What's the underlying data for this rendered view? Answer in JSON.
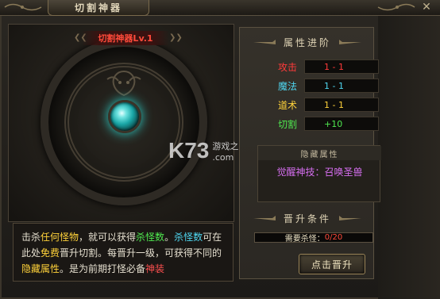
{
  "window": {
    "title": "切割神器",
    "close_icon": "close-icon"
  },
  "artifact": {
    "name": "切割神器Lv.1",
    "gem_color": "#2bd6cf"
  },
  "watermark": {
    "logo": "K73",
    "text": "游戏之家",
    "url": ".com"
  },
  "description": {
    "segments": [
      {
        "text": "击杀",
        "color": "default"
      },
      {
        "text": "任何怪物",
        "color": "yellow"
      },
      {
        "text": "，就可以获得",
        "color": "default"
      },
      {
        "text": "杀怪数",
        "color": "green"
      },
      {
        "text": "。",
        "color": "default"
      },
      {
        "text": "杀怪数",
        "color": "cyan"
      },
      {
        "text": "可在此处",
        "color": "default"
      },
      {
        "text": "免费",
        "color": "yellow"
      },
      {
        "text": "晋升切割。每晋升一级，可获得不同的",
        "color": "default"
      },
      {
        "text": "隐藏属性",
        "color": "yellow"
      },
      {
        "text": "。是为前期打怪必备",
        "color": "default"
      },
      {
        "text": "神装",
        "color": "red"
      }
    ]
  },
  "attributes": {
    "heading": "属性进阶",
    "rows": [
      {
        "label": "攻击",
        "value": "1 - 1",
        "label_color": "#ff3a3a",
        "value_color": "#ff3a3a"
      },
      {
        "label": "魔法",
        "value": "1 - 1",
        "label_color": "#4fd6f0",
        "value_color": "#4fd6f0"
      },
      {
        "label": "道术",
        "value": "1 - 1",
        "label_color": "#ffd23a",
        "value_color": "#ffd23a"
      },
      {
        "label": "切割",
        "value": "+10",
        "label_color": "#4fe84f",
        "value_color": "#4fe84f"
      }
    ]
  },
  "hidden": {
    "heading": "隐藏属性",
    "value": "觉醒神技：召唤圣兽"
  },
  "promotion": {
    "heading": "晋升条件",
    "kills_label": "需要杀怪：",
    "kills_value": "0/20",
    "progress": 0,
    "button": "点击晋升"
  }
}
